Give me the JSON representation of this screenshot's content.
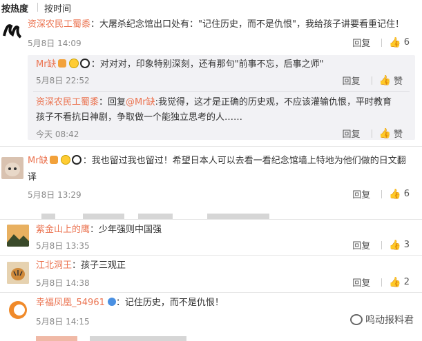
{
  "sort": {
    "hot": "按热度",
    "time": "按时间"
  },
  "comments": [
    {
      "user": "资深农民工蜀黍",
      "text": "：大屠杀纪念馆出口处有：\"记住历史，而不是仇恨\"，我给孩子讲要看重记住！",
      "date": "5月8日 14:09",
      "reply": "回复",
      "likes": "6",
      "avatar_colors": [
        "#111111",
        "#ffffff"
      ]
    },
    {
      "user": "Mr缺",
      "text": "：对对对，印象特别深刻，还有那句\"前事不忘，后事之师\"",
      "date": "5月8日 22:52",
      "reply": "回复",
      "likes": "赞"
    },
    {
      "user": "资深农民工蜀黍",
      "text_prefix": "：回复",
      "mention": "@Mr缺",
      "text": ":我觉得，这才是正确的历史观，不应该灌输仇恨，平时教育孩子不看抗日神剧，争取做一个能独立思考的人……",
      "date": "今天 08:42",
      "reply": "回复",
      "likes": "赞"
    },
    {
      "user": "Mr缺",
      "text": "：我也留过我也留过！希望日本人可以去看一看纪念馆墙上特地为他们做的日文翻译",
      "date": "5月8日 13:29",
      "reply": "回复",
      "likes": "6"
    },
    {
      "user": "紫金山上的鹰",
      "text": "：少年强则中国强",
      "date": "5月8日 13:35",
      "reply": "回复",
      "likes": "3"
    },
    {
      "user": "江北洞王",
      "text": "：孩子三观正",
      "date": "5月8日 14:38",
      "reply": "回复",
      "likes": "2"
    },
    {
      "user": "幸福凤凰_54961",
      "text": "：记住历史，而不是仇恨！",
      "date": "5月8日 14:15",
      "reply": "回复",
      "likes": ""
    }
  ],
  "watermark": "鸣动报料君",
  "colors": {
    "username": "#eb7350",
    "date": "#888888",
    "sub_bg": "#f2f2f5"
  }
}
